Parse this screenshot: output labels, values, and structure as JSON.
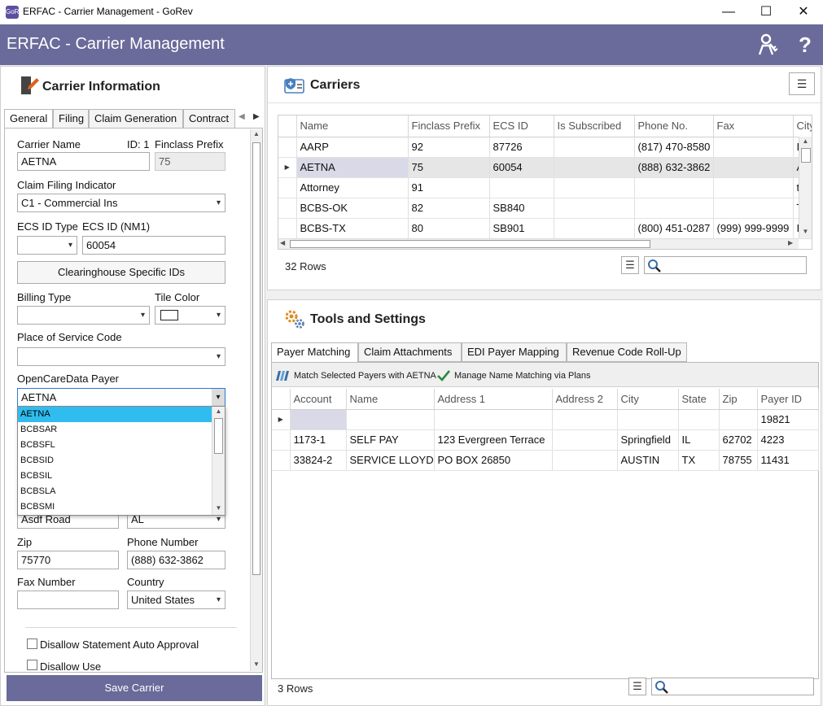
{
  "window": {
    "title": "ERFAC - Carrier Management - GoRev",
    "app_icon": "GoRev",
    "minimize": "—",
    "maximize": "☐",
    "close": "✕"
  },
  "header": {
    "title": "ERFAC - Carrier Management",
    "icons": [
      "user-key-icon",
      "help-icon"
    ],
    "help_glyph": "?",
    "bg": "#6a6a9b"
  },
  "carrier_info": {
    "title": "Carrier Information",
    "tabs": [
      "General",
      "Filing",
      "Claim Generation",
      "Contract"
    ],
    "carrier_name_label": "Carrier Name",
    "carrier_name_value": "AETNA",
    "id_label": "ID: 1",
    "finclass_label": "Finclass Prefix",
    "finclass_value": "75",
    "claim_filing_label": "Claim Filing Indicator",
    "claim_filing_value": "C1 - Commercial Ins",
    "ecs_id_type_label": "ECS ID Type",
    "ecs_id_label": "ECS ID (NM1)",
    "ecs_id_value": "60054",
    "clearinghouse_button": "Clearinghouse Specific IDs",
    "billing_type_label": "Billing Type",
    "tile_color_label": "Tile Color",
    "pos_label": "Place of Service Code",
    "ocd_label": "OpenCareData Payer",
    "ocd_value": "AETNA",
    "ocd_options": [
      "AETNA",
      "BCBSAR",
      "BCBSFL",
      "BCBSID",
      "BCBSIL",
      "BCBSLA",
      "BCBSMI"
    ],
    "address_value": "Asdf Road",
    "state_value": "AL",
    "zip_label": "Zip",
    "zip_value": "75770",
    "phone_label": "Phone Number",
    "phone_value": "(888) 632-3862",
    "fax_label": "Fax Number",
    "country_label": "Country",
    "country_value": "United States",
    "disallow_auto": "Disallow Statement Auto Approval",
    "disallow_use": "Disallow Use",
    "save_button": "Save Carrier"
  },
  "carriers": {
    "title": "Carriers",
    "columns": [
      "Name",
      "Finclass Prefix",
      "ECS ID",
      "Is Subscribed",
      "Phone No.",
      "Fax",
      "City"
    ],
    "rows": [
      [
        "AARP",
        "92",
        "87726",
        "",
        "(817) 470-8580",
        "",
        "I"
      ],
      [
        "AETNA",
        "75",
        "60054",
        "",
        "(888) 632-3862",
        "",
        "A"
      ],
      [
        "Attorney",
        "91",
        "",
        "",
        "",
        "",
        "t"
      ],
      [
        "BCBS-OK",
        "82",
        "SB840",
        "",
        "",
        "",
        "T"
      ],
      [
        "BCBS-TX",
        "80",
        "SB901",
        "",
        "(800) 451-0287",
        "(999) 999-9999",
        "I"
      ]
    ],
    "row_count": "32 Rows"
  },
  "tools": {
    "title": "Tools and Settings",
    "tabs": [
      "Payer Matching",
      "Claim Attachments",
      "EDI Payer Mapping",
      "Revenue Code Roll-Up"
    ],
    "match_button": "Match Selected Payers with AETNA",
    "manage_button": "Manage Name Matching via Plans",
    "columns": [
      "Account",
      "Name",
      "Address 1",
      "Address 2",
      "City",
      "State",
      "Zip",
      "Payer ID"
    ],
    "rows": [
      [
        "",
        "",
        "",
        "",
        "",
        "",
        "",
        "19821"
      ],
      [
        "1173-1",
        "SELF PAY",
        "123 Evergreen Terrace",
        "",
        "Springfield",
        "IL",
        "62702",
        "4223"
      ],
      [
        "33824-2",
        "SERVICE LLOYDS",
        "PO BOX 26850",
        "",
        "AUSTIN",
        "TX",
        "78755",
        "11431"
      ]
    ],
    "row_count": "3 Rows"
  }
}
